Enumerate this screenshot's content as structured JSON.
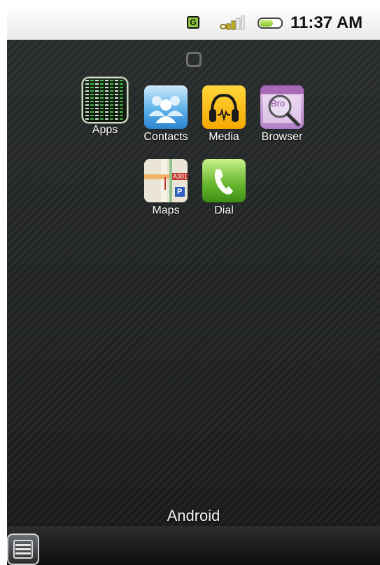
{
  "status_bar": {
    "network_badge": "G",
    "time": "11:37 AM",
    "battery_level": 0.58
  },
  "home": {
    "apps": [
      {
        "label": "Apps",
        "icon": "apps-grid-icon"
      },
      {
        "label": "Contacts",
        "icon": "contacts-icon"
      },
      {
        "label": "Media",
        "icon": "headphones-icon"
      },
      {
        "label": "Browser",
        "icon": "browser-magnifier-icon"
      },
      {
        "label": "Maps",
        "icon": "map-icon"
      },
      {
        "label": "Dial",
        "icon": "phone-icon"
      }
    ],
    "browser_badge": "Bro",
    "maps_badge": "A301",
    "maps_parking": "P",
    "apps_digits": [
      "9125874",
      "1961818",
      "33917"
    ]
  },
  "bottom": {
    "device_label": "Android"
  },
  "colors": {
    "background": "#222526",
    "status_bar": "#f2f2f2",
    "accent_green": "#7dc21e"
  }
}
